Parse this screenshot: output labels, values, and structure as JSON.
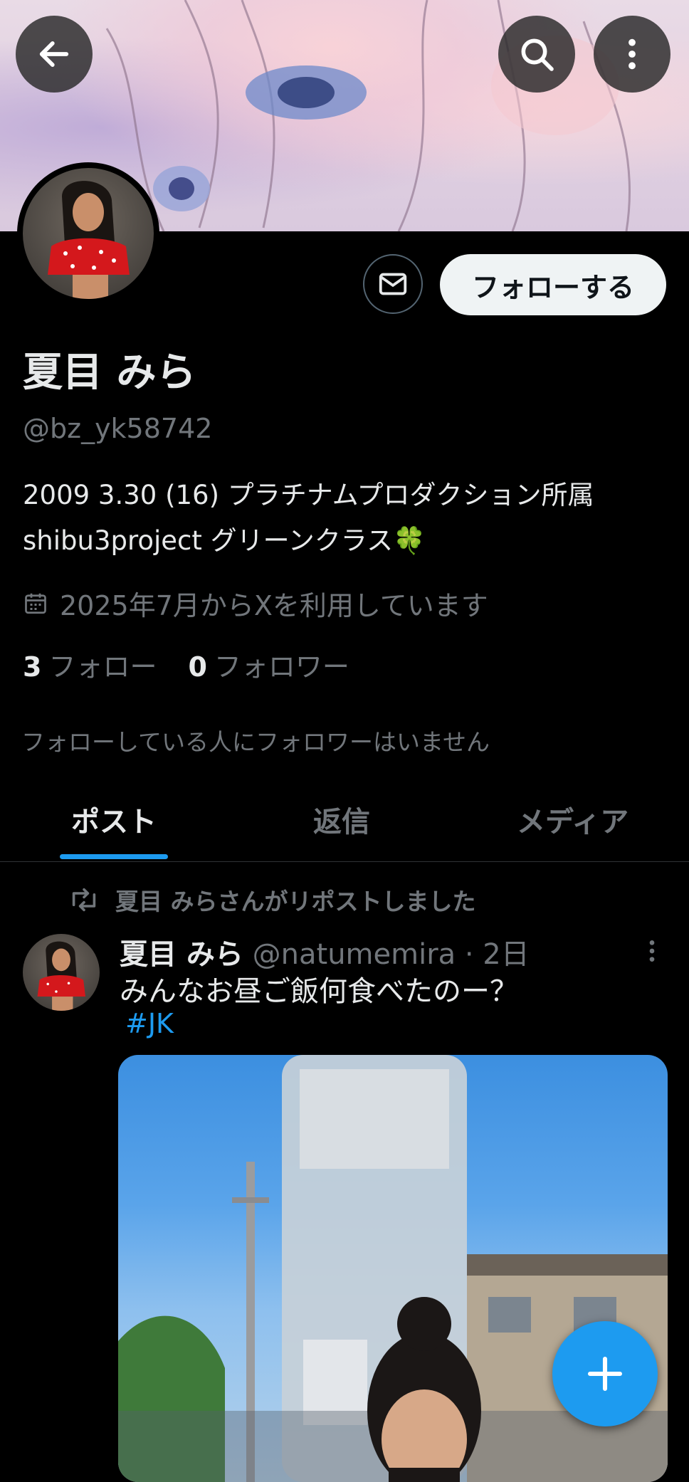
{
  "profile": {
    "name": "夏目 みら",
    "handle": "@bz_yk58742",
    "bio_line1": "2009 3.30 (16) プラチナムプロダクション所属",
    "bio_line2": "shibu3project グリーンクラス🍀",
    "joined": "2025年7月からXを利用しています",
    "following_count": "3",
    "following_label": "フォロー",
    "followers_count": "0",
    "followers_label": "フォロワー",
    "follow_button": "フォローする",
    "no_known_followers": "フォローしている人にフォロワーはいません"
  },
  "tabs": [
    {
      "label": "ポスト",
      "active": true
    },
    {
      "label": "返信",
      "active": false
    },
    {
      "label": "メディア",
      "active": false
    }
  ],
  "post": {
    "repost_notice": "夏目 みらさんがリポストしました",
    "author_name": "夏目 みら",
    "author_meta": "@natumemira · 2日",
    "text": "みんなお昼ご飯何食べたのー？",
    "hashtag": "#JK"
  },
  "icons": {
    "back": "arrow-left-icon",
    "search": "search-icon",
    "more": "more-vertical-icon",
    "message": "envelope-icon",
    "calendar": "calendar-icon",
    "repost": "repost-icon",
    "compose": "plus-icon"
  },
  "colors": {
    "accent": "#1d9bf0",
    "background": "#000000",
    "secondary_text": "#71767b"
  }
}
